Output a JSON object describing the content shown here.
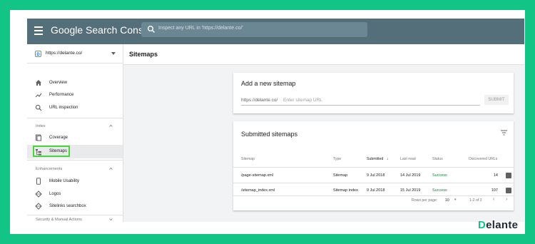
{
  "colors": {
    "frame": "#13c487",
    "topbar": "#546e7a",
    "success": "#188038",
    "highlight": "#4cd23b"
  },
  "topbar": {
    "brand": "Google Search Console",
    "search_placeholder": "Inspect any URL in 'https://delante.co/'"
  },
  "sidebar": {
    "property": "https://delante.co/",
    "items": [
      {
        "label": "Overview",
        "icon": "home-icon"
      },
      {
        "label": "Performance",
        "icon": "trending-up-icon"
      },
      {
        "label": "URL inspection",
        "icon": "search-icon"
      }
    ],
    "index_heading": "Index",
    "index_items": [
      {
        "label": "Coverage",
        "icon": "coverage-icon"
      },
      {
        "label": "Sitemaps",
        "icon": "sitemap-icon"
      }
    ],
    "enhancements_heading": "Enhancements",
    "enh_items": [
      {
        "label": "Mobile Usability",
        "icon": "phone-icon"
      },
      {
        "label": "Logos",
        "icon": "diamond-icon"
      },
      {
        "label": "Sitelinks searchbox",
        "icon": "diamond-icon"
      }
    ],
    "security_heading": "Security & Manual Actions"
  },
  "page": {
    "title": "Sitemaps"
  },
  "add": {
    "title": "Add a new sitemap",
    "prefix": "https://delante.co/",
    "placeholder": "Enter sitemap URL",
    "submit": "SUBMIT"
  },
  "submitted": {
    "title": "Submitted sitemaps",
    "columns": [
      "Sitemap",
      "Type",
      "Submitted",
      "Last read",
      "Status",
      "Discovered URLs"
    ],
    "rows": [
      {
        "sitemap": "/page-sitemap.xml",
        "type": "Sitemap",
        "submitted": "9 Jul 2018",
        "last_read": "14 Jul 2019",
        "status": "Success",
        "urls": "14"
      },
      {
        "sitemap": "/sitemap_index.xml",
        "type": "Sitemap index",
        "submitted": "9 Jul 2018",
        "last_read": "15 Jul 2019",
        "status": "Success",
        "urls": "107"
      }
    ],
    "rows_per_page_label": "Rows per page:",
    "rows_per_page": "10",
    "range": "1-2 of 2"
  },
  "logo": {
    "first": "D",
    "rest": "elante"
  }
}
